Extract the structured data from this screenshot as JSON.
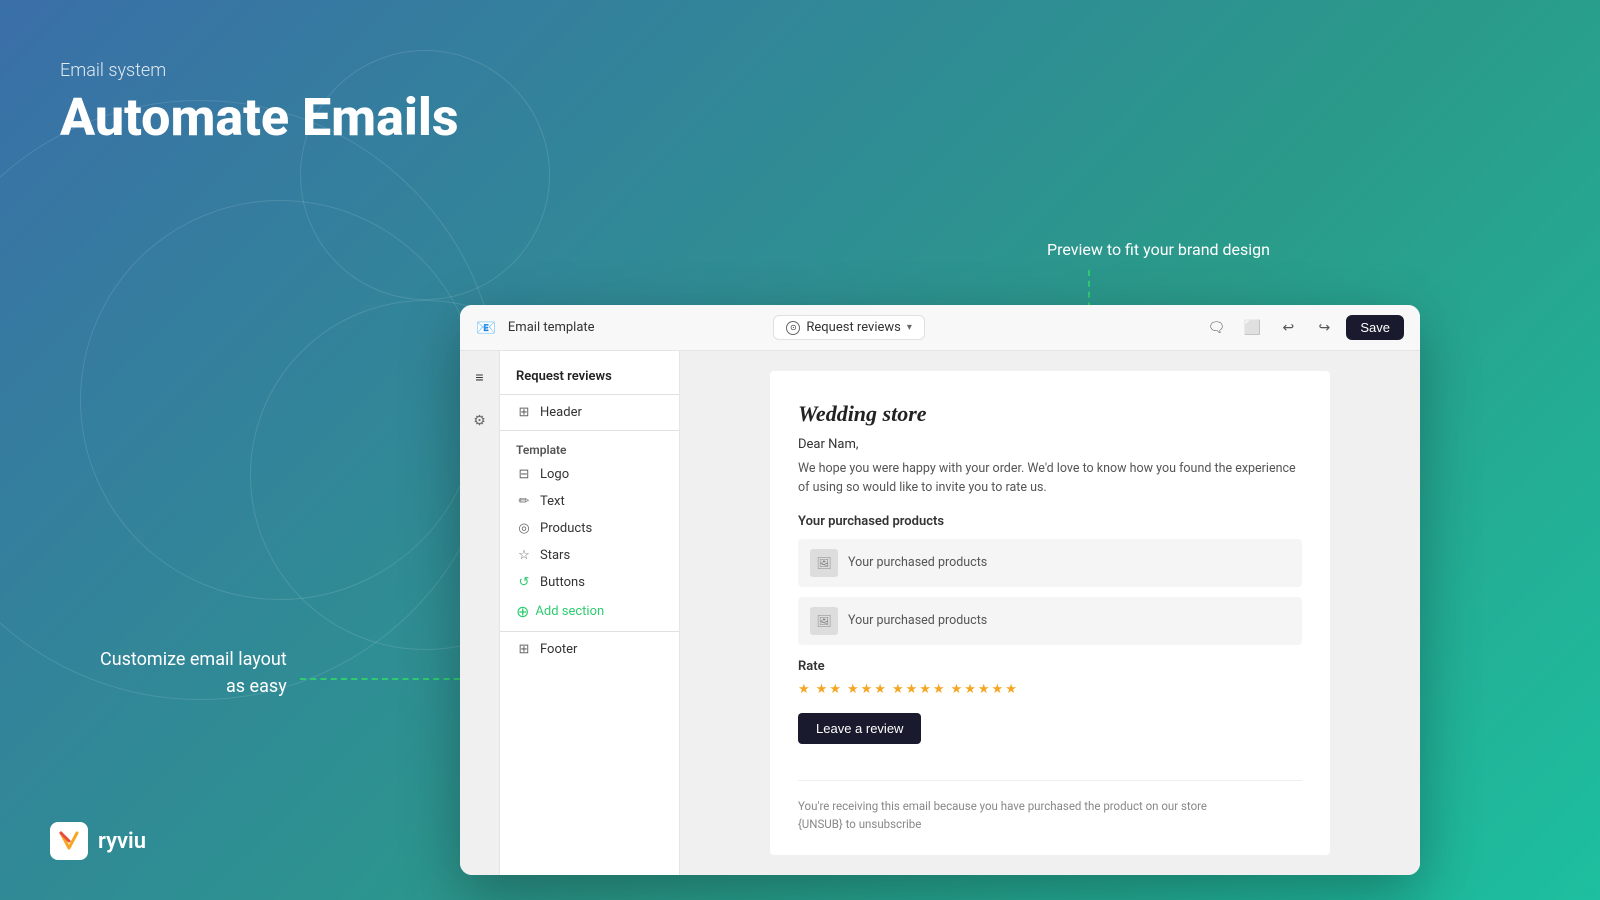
{
  "hero": {
    "subtitle": "Email system",
    "title": "Automate Emails"
  },
  "labels": {
    "preview": "Preview to fit your brand design",
    "customize": "Customize email layout\nas easy"
  },
  "logo": {
    "name": "ryviu"
  },
  "app": {
    "top_bar": {
      "icon": "📧",
      "title": "Email template",
      "tab_label": "Request reviews",
      "tab_chevron": "∨"
    },
    "toolbar": {
      "icons": [
        "🗨",
        "⬜",
        "↩",
        "↪"
      ],
      "save_label": "Save"
    },
    "sidebar": {
      "nav_icons": [
        "≡",
        "⚙"
      ],
      "section_title": "Request reviews",
      "header_item": "Header",
      "template_group": "Template",
      "items": [
        {
          "icon": "🖼",
          "label": "Logo"
        },
        {
          "icon": "✏",
          "label": "Text"
        },
        {
          "icon": "◎",
          "label": "Products"
        },
        {
          "icon": "☆",
          "label": "Stars"
        },
        {
          "icon": "↺",
          "label": "Buttons"
        }
      ],
      "add_section": "Add section",
      "footer_item": "Footer"
    },
    "email_preview": {
      "store_name": "Wedding store",
      "greeting": "Dear Nam,",
      "body_text": "We hope you were happy with your order. We'd love to know how you found the experience of using so would like to invite you to rate us.",
      "products_title": "Your purchased products",
      "products": [
        {
          "label": "Your purchased products"
        },
        {
          "label": "Your purchased products"
        }
      ],
      "rate_title": "Rate",
      "review_button": "Leave a review",
      "footer_line1": "You're receiving this email because you have purchased the product on our store",
      "footer_line2": "{UNSUB} to unsubscribe"
    }
  }
}
